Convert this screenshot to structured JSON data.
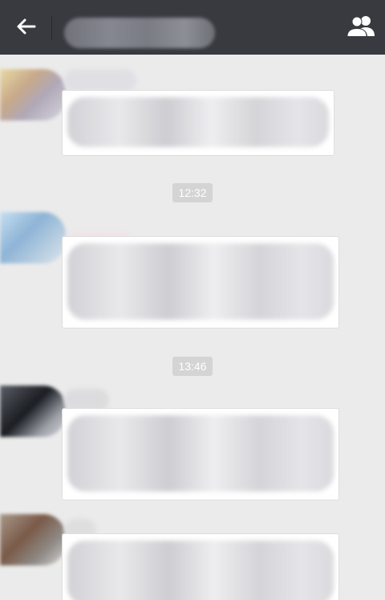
{
  "header": {
    "back_icon": "arrow-left-icon",
    "group_icon": "group-members-icon",
    "title": ""
  },
  "messages": {
    "timestamps": [
      "12:32",
      "13:46"
    ]
  },
  "colors": {
    "topbar": "#393a3f",
    "background": "#ebebeb",
    "bubble": "#ffffff",
    "timestamp_bg": "#d4d4d4"
  }
}
